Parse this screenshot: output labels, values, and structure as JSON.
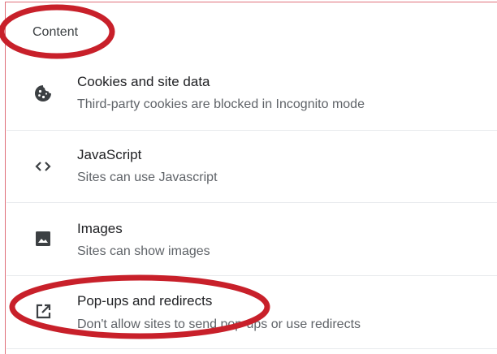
{
  "section": {
    "title": "Content"
  },
  "items": [
    {
      "title": "Cookies and site data",
      "subtitle": "Third-party cookies are blocked in Incognito mode",
      "icon": "cookie-icon"
    },
    {
      "title": "JavaScript",
      "subtitle": "Sites can use Javascript",
      "icon": "code-icon"
    },
    {
      "title": "Images",
      "subtitle": "Sites can show images",
      "icon": "image-icon"
    },
    {
      "title": "Pop-ups and redirects",
      "subtitle": "Don't allow sites to send pop-ups or use redirects",
      "icon": "open-in-new-icon"
    }
  ],
  "colors": {
    "annotation": "#c8202a",
    "frame": "#e0707a",
    "divider": "#e8eaed"
  }
}
